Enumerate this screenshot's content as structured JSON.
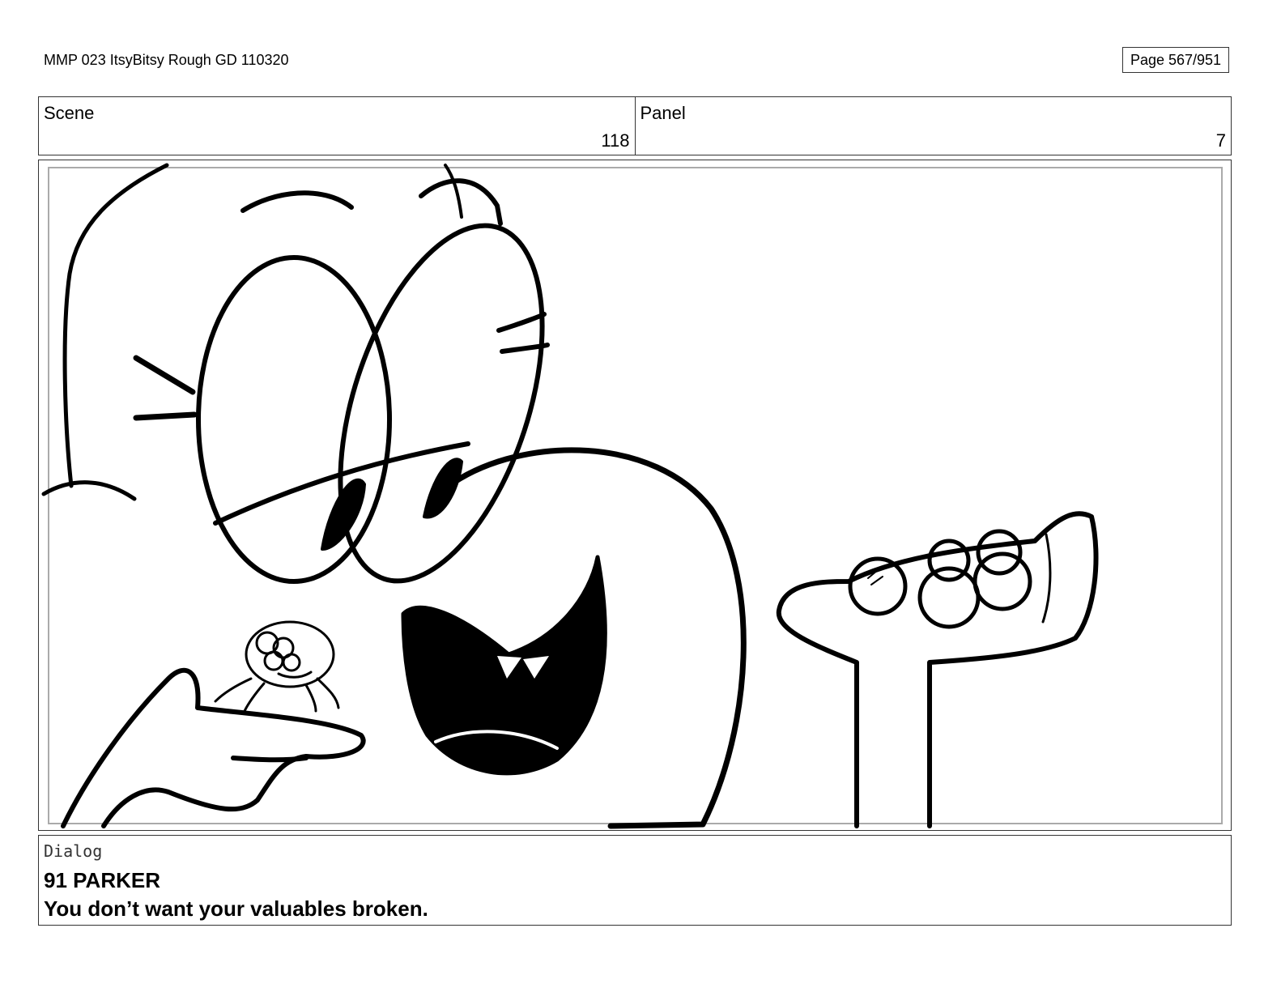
{
  "header": {
    "document_title": "MMP 023 ItsyBitsy Rough GD 110320",
    "page_indicator": "Page 567/951"
  },
  "info": {
    "scene_label": "Scene",
    "scene_value": "118",
    "panel_label": "Panel",
    "panel_value": "7"
  },
  "dialog": {
    "label": "Dialog",
    "speaker": "91 PARKER",
    "line": "You don’t want your valuables broken."
  }
}
